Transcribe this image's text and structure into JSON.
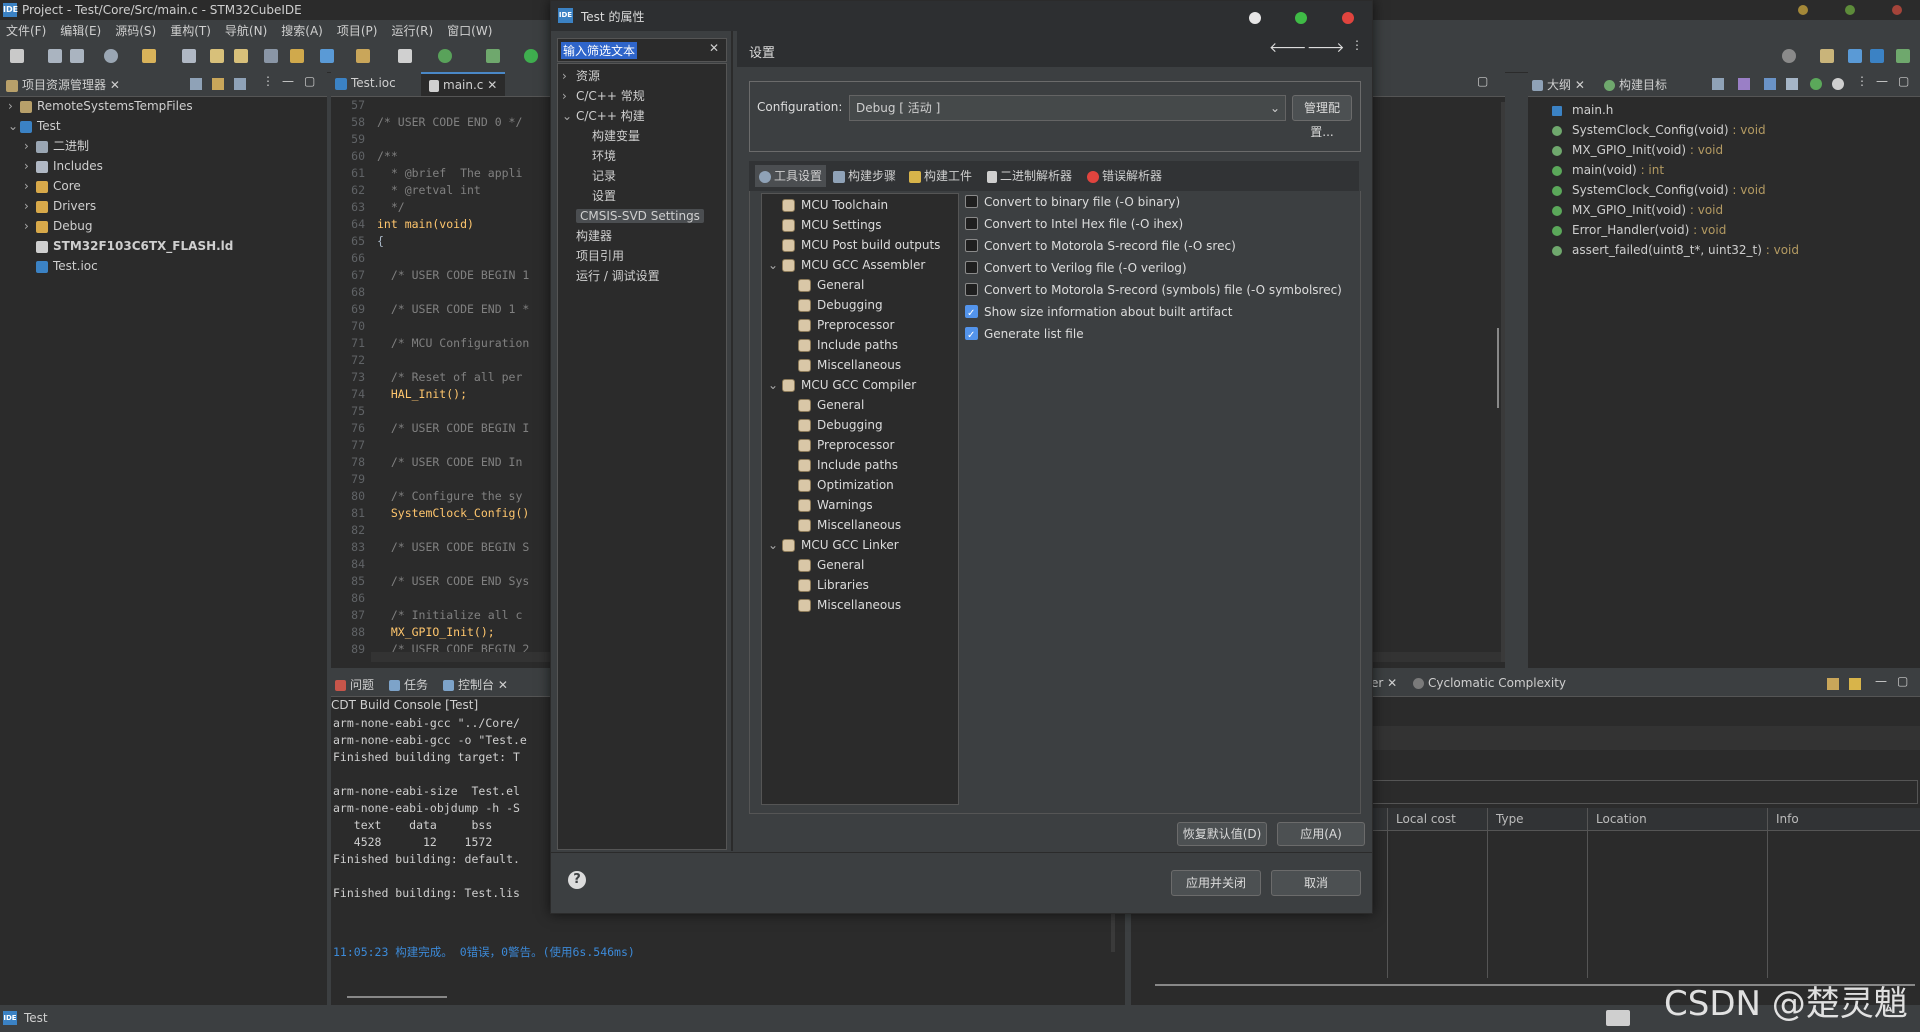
{
  "window": {
    "title": "Project - Test/Core/Src/main.c - STM32CubeIDE"
  },
  "menu": [
    "文件(F)",
    "编辑(E)",
    "源码(S)",
    "重构(T)",
    "导航(N)",
    "搜索(A)",
    "项目(P)",
    "运行(R)",
    "窗口(W)"
  ],
  "explorer": {
    "tab": "项目资源管理器",
    "items": [
      {
        "label": "RemoteSystemsTempFiles"
      },
      {
        "label": "Test"
      },
      {
        "label": "二进制"
      },
      {
        "label": "Includes"
      },
      {
        "label": "Core"
      },
      {
        "label": "Drivers"
      },
      {
        "label": "Debug"
      },
      {
        "label": "STM32F103C6TX_FLASH.ld"
      },
      {
        "label": "Test.ioc"
      }
    ]
  },
  "editor": {
    "tabs": [
      "Test.ioc",
      "main.c"
    ],
    "lines": [
      {
        "n": "57",
        "t": ""
      },
      {
        "n": "58",
        "t": "/* USER CODE END 0 */"
      },
      {
        "n": "59",
        "t": ""
      },
      {
        "n": "60",
        "t": "/**"
      },
      {
        "n": "61",
        "t": "  * @brief  The appli"
      },
      {
        "n": "62",
        "t": "  * @retval int"
      },
      {
        "n": "63",
        "t": "  */"
      },
      {
        "n": "64",
        "t": "int main(void)"
      },
      {
        "n": "65",
        "t": "{"
      },
      {
        "n": "66",
        "t": ""
      },
      {
        "n": "67",
        "t": "  /* USER CODE BEGIN 1"
      },
      {
        "n": "68",
        "t": ""
      },
      {
        "n": "69",
        "t": "  /* USER CODE END 1 *"
      },
      {
        "n": "70",
        "t": ""
      },
      {
        "n": "71",
        "t": "  /* MCU Configuration"
      },
      {
        "n": "72",
        "t": ""
      },
      {
        "n": "73",
        "t": "  /* Reset of all per"
      },
      {
        "n": "74",
        "t": "  HAL_Init();"
      },
      {
        "n": "75",
        "t": ""
      },
      {
        "n": "76",
        "t": "  /* USER CODE BEGIN I"
      },
      {
        "n": "77",
        "t": ""
      },
      {
        "n": "78",
        "t": "  /* USER CODE END In"
      },
      {
        "n": "79",
        "t": ""
      },
      {
        "n": "80",
        "t": "  /* Configure the sy"
      },
      {
        "n": "81",
        "t": "  SystemClock_Config()"
      },
      {
        "n": "82",
        "t": ""
      },
      {
        "n": "83",
        "t": "  /* USER CODE BEGIN S"
      },
      {
        "n": "84",
        "t": ""
      },
      {
        "n": "85",
        "t": "  /* USER CODE END Sys"
      },
      {
        "n": "86",
        "t": ""
      },
      {
        "n": "87",
        "t": "  /* Initialize all c"
      },
      {
        "n": "88",
        "t": "  MX_GPIO_Init();"
      },
      {
        "n": "89",
        "t": "  /* USER CODE BEGIN 2"
      }
    ]
  },
  "console": {
    "tabs": [
      "问题",
      "任务",
      "控制台"
    ],
    "header": "CDT Build Console [Test]",
    "lines": [
      "arm-none-eabi-gcc \"../Core/",
      "arm-none-eabi-gcc -o \"Test.e",
      "Finished building target: T",
      "",
      "arm-none-eabi-size  Test.el",
      "arm-none-eabi-objdump -h -S",
      "   text    data     bss",
      "   4528      12    1572",
      "Finished building: default.",
      "",
      "Finished building: Test.lis"
    ],
    "status": "11:05:23 构建完成。 0错误，0警告。(使用6s.546ms)"
  },
  "outline": {
    "tabs": [
      "大纲",
      "构建目标"
    ],
    "items": [
      {
        "name": "main.h",
        "type": ""
      },
      {
        "name": "SystemClock_Config(void)",
        "type": " : void"
      },
      {
        "name": "MX_GPIO_Init(void)",
        "type": " : void"
      },
      {
        "name": "main(void)",
        "type": " : int"
      },
      {
        "name": "SystemClock_Config(void)",
        "type": " : void"
      },
      {
        "name": "MX_GPIO_Init(void)",
        "type": " : void"
      },
      {
        "name": "Error_Handler(void)",
        "type": " : void"
      },
      {
        "name": "assert_failed(uint8_t*, uint32_t)",
        "type": " : void"
      }
    ]
  },
  "bottom_right": {
    "tab": "Cyclomatic Complexity",
    "tab_partial": "er",
    "columns": [
      "Local cost",
      "Type",
      "Location",
      "Info"
    ]
  },
  "statusbar": {
    "project": "Test"
  },
  "watermark": "CSDN @楚灵魈",
  "dialog": {
    "title": "Test 的属性",
    "filter_placeholder": "输入筛选文本",
    "nav": [
      {
        "label": "资源"
      },
      {
        "label": "C/C++ 常规"
      },
      {
        "label": "C/C++ 构建"
      },
      {
        "label": "构建变量"
      },
      {
        "label": "环境"
      },
      {
        "label": "记录"
      },
      {
        "label": "设置"
      },
      {
        "label": "CMSIS-SVD Settings"
      },
      {
        "label": "构建器"
      },
      {
        "label": "项目引用"
      },
      {
        "label": "运行 / 调试设置"
      }
    ],
    "section_title": "设置",
    "config_label": "Configuration:",
    "config_value": "Debug  [ 活动 ]",
    "manage_button": "管理配置...",
    "subtabs": [
      "工具设置",
      "构建步骤",
      "构建工件",
      "二进制解析器",
      "错误解析器"
    ],
    "tool_tree": [
      {
        "label": "MCU Toolchain"
      },
      {
        "label": "MCU Settings"
      },
      {
        "label": "MCU Post build outputs"
      },
      {
        "label": "MCU GCC Assembler"
      },
      {
        "label": "General"
      },
      {
        "label": "Debugging"
      },
      {
        "label": "Preprocessor"
      },
      {
        "label": "Include paths"
      },
      {
        "label": "Miscellaneous"
      },
      {
        "label": "MCU GCC Compiler"
      },
      {
        "label": "General"
      },
      {
        "label": "Debugging"
      },
      {
        "label": "Preprocessor"
      },
      {
        "label": "Include paths"
      },
      {
        "label": "Optimization"
      },
      {
        "label": "Warnings"
      },
      {
        "label": "Miscellaneous"
      },
      {
        "label": "MCU GCC Linker"
      },
      {
        "label": "General"
      },
      {
        "label": "Libraries"
      },
      {
        "label": "Miscellaneous"
      }
    ],
    "options": [
      {
        "label": "Convert to binary file (-O binary)",
        "checked": false
      },
      {
        "label": "Convert to Intel Hex file (-O ihex)",
        "checked": false
      },
      {
        "label": "Convert to Motorola S-record file (-O srec)",
        "checked": false
      },
      {
        "label": "Convert to Verilog file (-O verilog)",
        "checked": false
      },
      {
        "label": "Convert to Motorola S-record (symbols) file (-O symbolsrec)",
        "checked": false
      },
      {
        "label": "Show size information about built artifact",
        "checked": true
      },
      {
        "label": "Generate list file",
        "checked": true
      }
    ],
    "restore_button": "恢复默认值(D)",
    "apply_button": "应用(A)",
    "apply_close_button": "应用并关闭",
    "cancel_button": "取消",
    "help_icon": "?"
  }
}
